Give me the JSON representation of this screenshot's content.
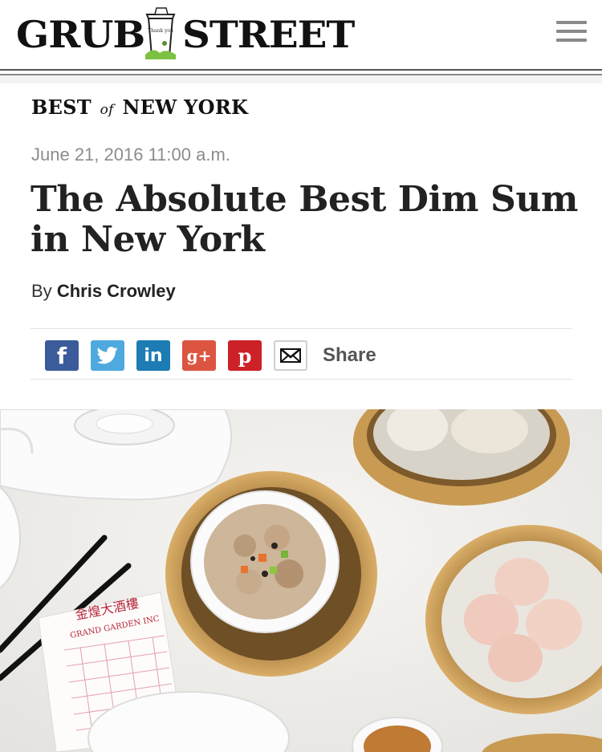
{
  "brand": {
    "logo_left": "GRUB",
    "logo_right": "STREET",
    "logo_cup_text": "Thank you"
  },
  "header": {
    "menu_icon": "hamburger-menu-icon"
  },
  "section": {
    "best": "BEST",
    "of": "of",
    "region": "NEW YORK"
  },
  "article": {
    "date": "June 21, 2016 11:00 a.m.",
    "title": "The Absolute Best Dim Sum in New York",
    "by": "By",
    "author": "Chris Crowley"
  },
  "share": {
    "facebook": "f",
    "linkedin": "in",
    "googleplus": "g+",
    "pinterest": "p",
    "label": "Share",
    "icons": [
      "facebook-icon",
      "twitter-icon",
      "linkedin-icon",
      "google-plus-icon",
      "pinterest-icon",
      "email-icon"
    ]
  },
  "hero": {
    "receipt_chinese": "金煌大酒樓",
    "receipt_english": "GRAND GARDEN INC"
  },
  "colors": {
    "facebook": "#3b5b9a",
    "twitter": "#4ea9de",
    "linkedin": "#1d7cb3",
    "googleplus": "#db5540",
    "pinterest": "#cc2127",
    "bamboo": "#c89a52"
  }
}
